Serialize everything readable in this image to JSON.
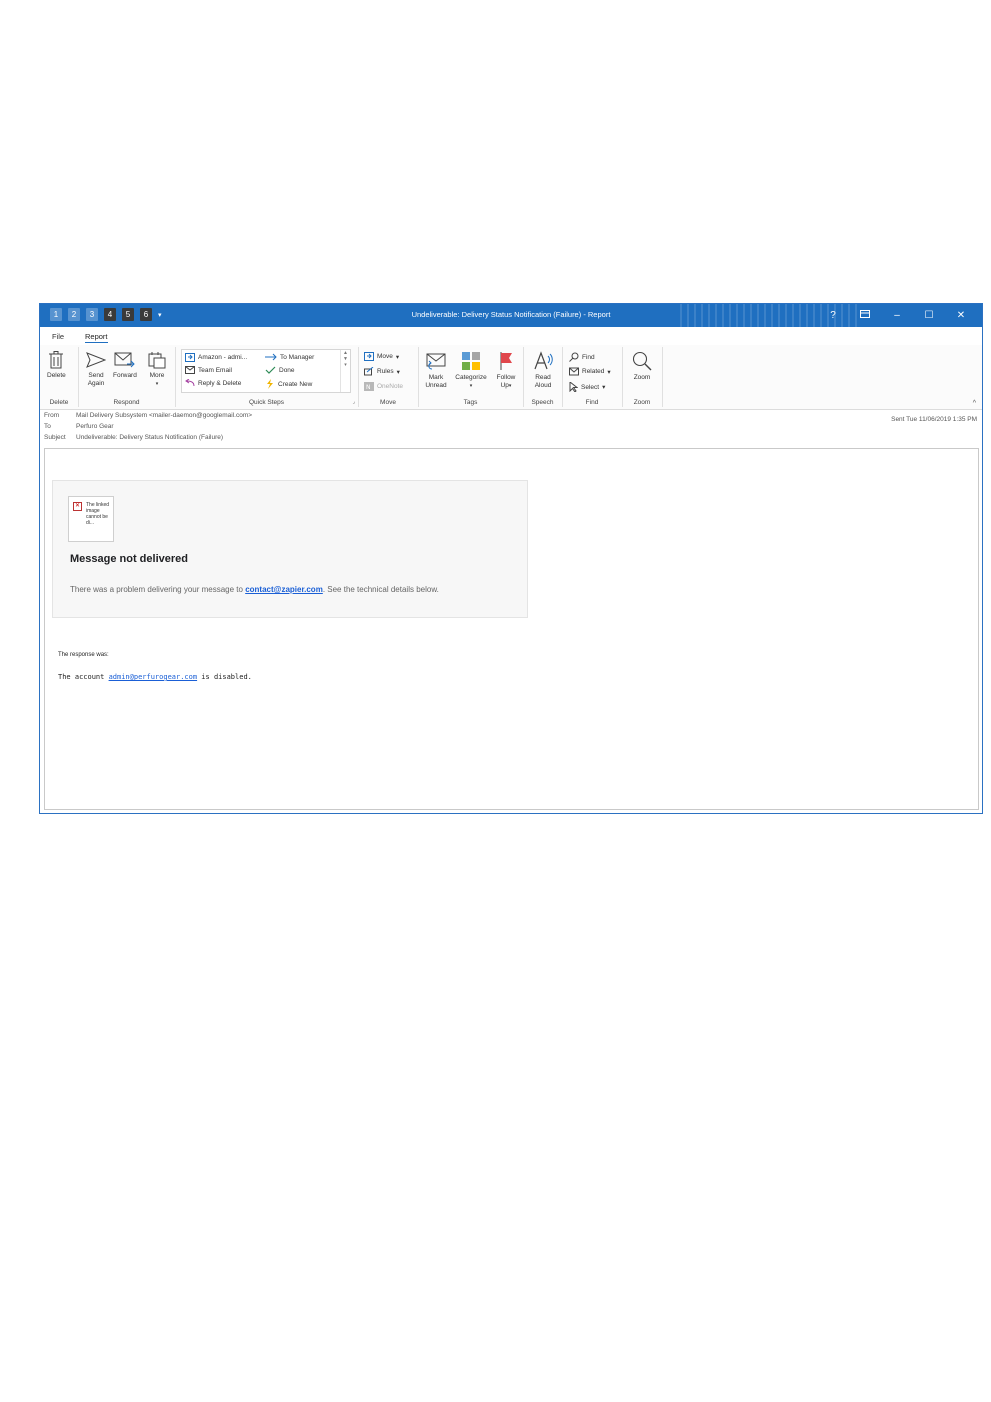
{
  "window": {
    "title": "Undeliverable: Delivery Status Notification (Failure)  -  Report",
    "qat_keys": [
      "1",
      "2",
      "3",
      "4",
      "5",
      "6"
    ],
    "help": "?",
    "controls": {
      "minimize": "–",
      "maximize": "☐",
      "close": "✕"
    }
  },
  "tabs": [
    "File",
    "Report"
  ],
  "ribbon": {
    "delete_group": {
      "label": "Delete",
      "delete": "Delete"
    },
    "respond_group": {
      "label": "Respond",
      "send_again": "Send Again",
      "forward": "Forward",
      "more": "More"
    },
    "quick_steps": {
      "label": "Quick Steps",
      "items": [
        "Amazon - admi...",
        "To Manager",
        "Team Email",
        "Done",
        "Reply & Delete",
        "Create New"
      ]
    },
    "move_group": {
      "label": "Move",
      "move": "Move",
      "rules": "Rules",
      "onenote": "OneNote"
    },
    "tags_group": {
      "label": "Tags",
      "mark_unread": "Mark Unread",
      "categorize": "Categorize",
      "follow_up": "Follow Up"
    },
    "speech_group": {
      "label": "Speech",
      "read_aloud": "Read Aloud"
    },
    "find_group": {
      "label": "Find",
      "find": "Find",
      "related": "Related",
      "select": "Select"
    },
    "zoom_group": {
      "label": "Zoom",
      "zoom": "Zoom"
    }
  },
  "header": {
    "from_label": "From",
    "from": "Mail Delivery Subsystem <mailer-daemon@googlemail.com>",
    "to_label": "To",
    "to": "Perfuro Gear",
    "subject_label": "Subject",
    "subject": "Undeliverable: Delivery Status Notification (Failure)",
    "sent": "Sent   Tue 11/06/2019 1:35 PM"
  },
  "message": {
    "broken_image_alt": "The linked image cannot be di...",
    "headline": "Message not delivered",
    "desc_prefix": "There was a problem delivering your message to ",
    "recipient": "contact@zapier.com",
    "desc_suffix": ". See the technical details below.",
    "response_label": "The response was:",
    "response_prefix": "The account ",
    "response_email": "admin@perfurogear.com",
    "response_suffix": " is disabled."
  },
  "colors": {
    "accent": "#1f6fc0",
    "link": "#1a5fd6",
    "flag": "#e0474c"
  }
}
